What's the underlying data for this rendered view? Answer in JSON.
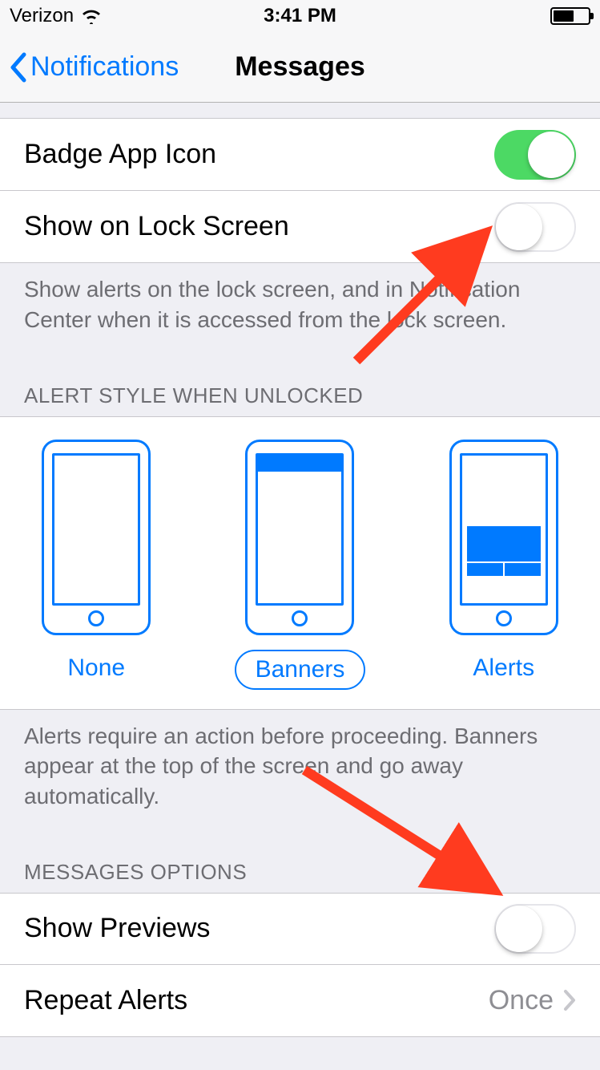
{
  "status": {
    "carrier": "Verizon",
    "time": "3:41 PM"
  },
  "nav": {
    "back_label": "Notifications",
    "title": "Messages"
  },
  "rows": {
    "badge_app_icon": "Badge App Icon",
    "show_lock_screen": "Show on Lock Screen",
    "show_previews": "Show Previews",
    "repeat_alerts": "Repeat Alerts",
    "repeat_alerts_value": "Once"
  },
  "footers": {
    "lock_screen": "Show alerts on the lock screen, and in Notification Center when it is accessed from the lock screen.",
    "alerts": "Alerts require an action before proceeding. Banners appear at the top of the screen and go away automatically."
  },
  "headers": {
    "alert_style": "ALERT STYLE WHEN UNLOCKED",
    "messages_options": "MESSAGES OPTIONS"
  },
  "styles": {
    "none": "None",
    "banners": "Banners",
    "alerts": "Alerts"
  },
  "toggles": {
    "badge_app_icon": true,
    "show_lock_screen": false,
    "show_previews": false
  },
  "selected_style": "banners"
}
